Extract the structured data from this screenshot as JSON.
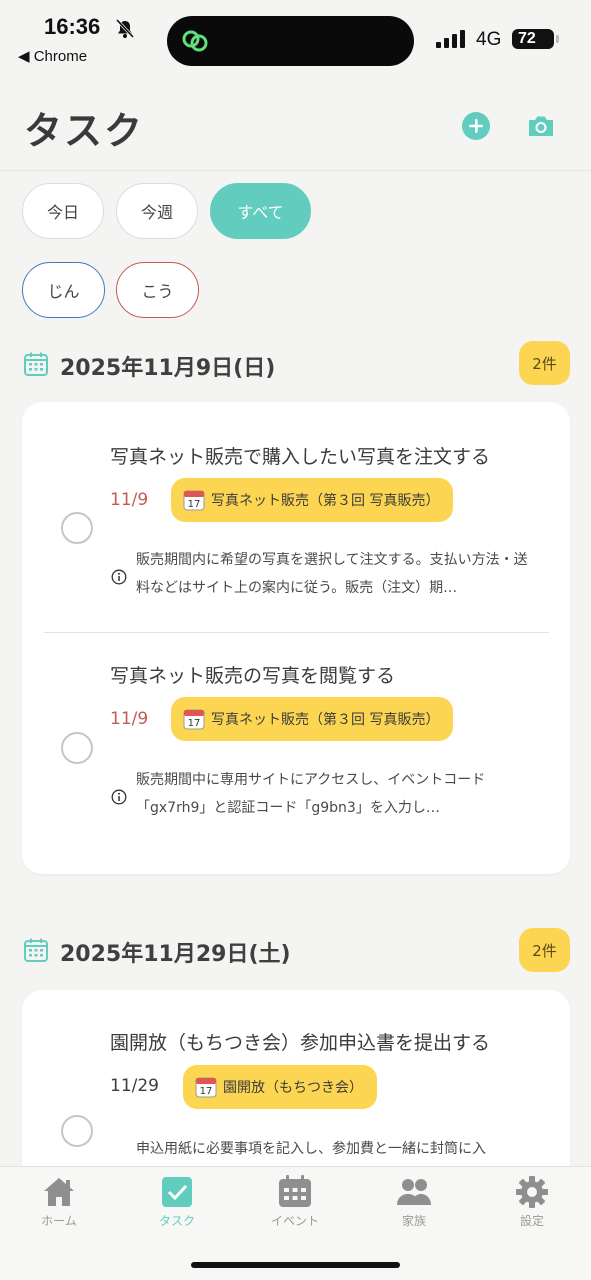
{
  "status_bar": {
    "time": "16:36",
    "back_app": "◀ Chrome",
    "network": "4G",
    "battery": "72"
  },
  "header": {
    "title": "タスク",
    "add_icon": "plus-circle-icon",
    "camera_icon": "camera-icon"
  },
  "filters": {
    "period": [
      {
        "label": "今日",
        "active": false
      },
      {
        "label": "今週",
        "active": false
      },
      {
        "label": "すべて",
        "active": true
      }
    ],
    "people": [
      {
        "label": "じん",
        "color": "#3d7bbf"
      },
      {
        "label": "こう",
        "color": "#c9584b"
      }
    ]
  },
  "groups": [
    {
      "date": "2025年11月9日(日)",
      "count": "2件",
      "tasks": [
        {
          "title": "写真ネット販売で購入したい写真を注文する",
          "date": "11/9",
          "event": "写真ネット販売（第３回 写真販売）",
          "note": "販売期間内に希望の写真を選択して注文する。支払い方法・送料などはサイト上の案内に従う。販売（注文）期…"
        },
        {
          "title": "写真ネット販売の写真を閲覧する",
          "date": "11/9",
          "event": "写真ネット販売（第３回 写真販売）",
          "note": "販売期間中に専用サイトにアクセスし、イベントコード「gx7rh9」と認証コード「g9bn3」を入力し…"
        }
      ]
    },
    {
      "date": "2025年11月29日(土)",
      "count": "2件",
      "tasks": [
        {
          "title": "園開放（もちつき会）参加申込書を提出する",
          "date": "11/29",
          "event": "園開放（もちつき会）",
          "note": "申込用紙に必要事項を記入し、参加費と一緒に封筒に入"
        }
      ]
    }
  ],
  "tabbar": {
    "items": [
      {
        "label": "ホーム",
        "icon": "home-icon",
        "active": false
      },
      {
        "label": "タスク",
        "icon": "task-check-icon",
        "active": true
      },
      {
        "label": "イベント",
        "icon": "calendar-icon",
        "active": false
      },
      {
        "label": "家族",
        "icon": "family-icon",
        "active": false
      },
      {
        "label": "設定",
        "icon": "gear-icon",
        "active": false
      }
    ]
  },
  "colors": {
    "accent": "#62cdbf",
    "badge_yellow": "#fcd652",
    "date_red": "#c25a55"
  }
}
